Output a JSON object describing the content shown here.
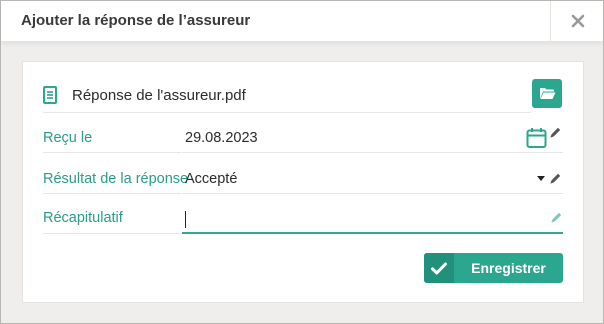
{
  "dialog": {
    "title": "Ajouter la réponse de l’assureur",
    "close_icon": "close-icon"
  },
  "file": {
    "name": "Réponse de l'assureur.pdf",
    "icon": "document-icon",
    "browse_icon": "folder-icon"
  },
  "fields": {
    "received": {
      "label": "Reçu le",
      "value": "29.08.2023",
      "icon": "calendar-icon"
    },
    "result": {
      "label": "Résultat de la réponse",
      "value": "Accepté"
    },
    "summary": {
      "label": "Récapitulatif",
      "value": ""
    }
  },
  "actions": {
    "save_label": "Enregistrer",
    "save_icon": "check-icon"
  },
  "colors": {
    "accent": "#2aa78e",
    "accent_dark": "#22917b",
    "label": "#2b9c8a"
  }
}
